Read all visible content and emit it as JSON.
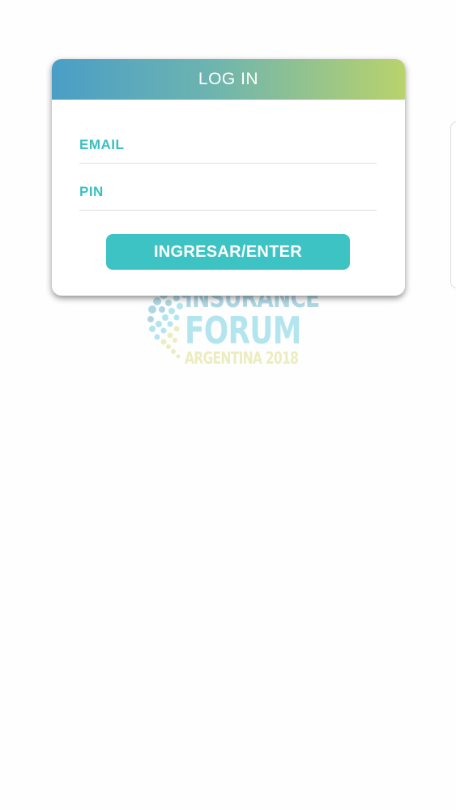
{
  "login_card": {
    "title": "LOG IN",
    "email_placeholder": "EMAIL",
    "email_value": "",
    "pin_placeholder": "PIN",
    "pin_value": "",
    "enter_label": "INGRESAR/ENTER"
  },
  "logo": {
    "line1": "INSURANCE",
    "line2": "FORUM",
    "line3": "ARGENTINA 2018",
    "icon": "dotted-swirl-icon"
  },
  "colors": {
    "header_gradient_start": "#4a9ec6",
    "header_gradient_end": "#b9d26c",
    "accent": "#3dc3c3",
    "background": "#fefefe"
  }
}
